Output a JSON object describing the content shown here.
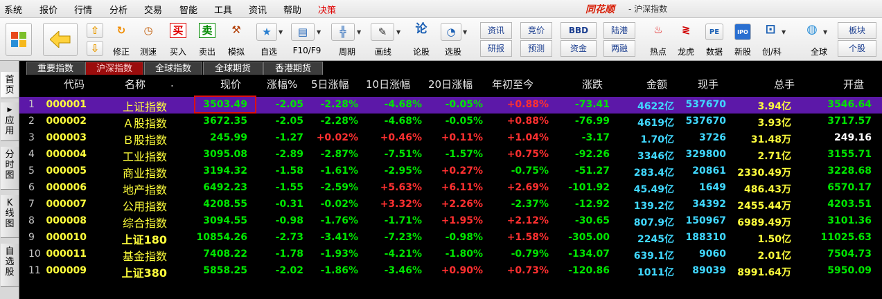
{
  "menu": [
    "系统",
    "报价",
    "行情",
    "分析",
    "交易",
    "智能",
    "工具",
    "资讯",
    "帮助",
    "决策"
  ],
  "app": {
    "title": "同花顺",
    "subtitle": "- 沪深指数"
  },
  "toolbar": {
    "labels": [
      "修正",
      "测速",
      "买入",
      "卖出",
      "模拟",
      "自选",
      "F10/F9",
      "周期",
      "画线",
      "论股",
      "选股",
      "热点",
      "龙虎",
      "数据",
      "新股",
      "创/科",
      "全球"
    ],
    "glyphs": {
      "buy": "买",
      "sell": "卖",
      "lun": "论",
      "bbd": "BBD",
      "pe": "PE",
      "ipo": "IPO"
    },
    "pairs": [
      [
        "资讯",
        "研报"
      ],
      [
        "竞价",
        "预测"
      ],
      [
        "BBD",
        "资金"
      ],
      [
        "陆港",
        "两融"
      ],
      [
        "板块",
        "个股"
      ]
    ]
  },
  "side_tabs": [
    "首页",
    "应用",
    "分时图",
    "K线图",
    "自选股"
  ],
  "tabs": [
    "重要指数",
    "沪深指数",
    "全球指数",
    "全球期货",
    "香港期货"
  ],
  "active_tab": "沪深指数",
  "columns": [
    "代码",
    "名称",
    ".",
    "现价",
    "涨幅%",
    "5日涨幅",
    "10日涨幅",
    "20日涨幅",
    "年初至今",
    "涨跌",
    "金额",
    "现手",
    "总手",
    "开盘"
  ],
  "rows": [
    {
      "n": "1",
      "code": "000001",
      "name": "上证指数",
      "price": "3503.49",
      "chg": "-2.05",
      "d5": "-2.28%",
      "d10": "-4.68%",
      "d20": "-0.05%",
      "ytd": "+0.88%",
      "diff": "-73.41",
      "amt": "4622亿",
      "hand": "537670",
      "vol": "3.94亿",
      "open": "3546.64"
    },
    {
      "n": "2",
      "code": "000002",
      "name": "Ａ股指数",
      "price": "3672.35",
      "chg": "-2.05",
      "d5": "-2.28%",
      "d10": "-4.68%",
      "d20": "-0.05%",
      "ytd": "+0.88%",
      "diff": "-76.99",
      "amt": "4619亿",
      "hand": "537670",
      "vol": "3.93亿",
      "open": "3717.57"
    },
    {
      "n": "3",
      "code": "000003",
      "name": "Ｂ股指数",
      "price": "245.99",
      "chg": "-1.27",
      "d5": "+0.02%",
      "d10": "+0.46%",
      "d20": "+0.11%",
      "ytd": "+1.04%",
      "diff": "-3.17",
      "amt": "1.70亿",
      "hand": "3726",
      "vol": "31.48万",
      "open": "249.16"
    },
    {
      "n": "4",
      "code": "000004",
      "name": "工业指数",
      "price": "3095.08",
      "chg": "-2.89",
      "d5": "-2.87%",
      "d10": "-7.51%",
      "d20": "-1.57%",
      "ytd": "+0.75%",
      "diff": "-92.26",
      "amt": "3346亿",
      "hand": "329800",
      "vol": "2.71亿",
      "open": "3155.71"
    },
    {
      "n": "5",
      "code": "000005",
      "name": "商业指数",
      "price": "3194.32",
      "chg": "-1.58",
      "d5": "-1.61%",
      "d10": "-2.95%",
      "d20": "+0.27%",
      "ytd": "-0.75%",
      "diff": "-51.27",
      "amt": "283.4亿",
      "hand": "20861",
      "vol": "2330.49万",
      "open": "3228.68"
    },
    {
      "n": "6",
      "code": "000006",
      "name": "地产指数",
      "price": "6492.23",
      "chg": "-1.55",
      "d5": "-2.59%",
      "d10": "+5.63%",
      "d20": "+6.11%",
      "ytd": "+2.69%",
      "diff": "-101.92",
      "amt": "45.49亿",
      "hand": "1649",
      "vol": "486.43万",
      "open": "6570.17"
    },
    {
      "n": "7",
      "code": "000007",
      "name": "公用指数",
      "price": "4208.55",
      "chg": "-0.31",
      "d5": "-0.02%",
      "d10": "+3.32%",
      "d20": "+2.26%",
      "ytd": "-2.37%",
      "diff": "-12.92",
      "amt": "139.2亿",
      "hand": "34392",
      "vol": "2455.44万",
      "open": "4203.51"
    },
    {
      "n": "8",
      "code": "000008",
      "name": "综合指数",
      "price": "3094.55",
      "chg": "-0.98",
      "d5": "-1.76%",
      "d10": "-1.71%",
      "d20": "+1.95%",
      "ytd": "+2.12%",
      "diff": "-30.65",
      "amt": "807.9亿",
      "hand": "150967",
      "vol": "6989.49万",
      "open": "3101.36"
    },
    {
      "n": "9",
      "code": "000010",
      "name": "上证180",
      "price": "10854.26",
      "chg": "-2.73",
      "d5": "-3.41%",
      "d10": "-7.23%",
      "d20": "-0.98%",
      "ytd": "+1.58%",
      "diff": "-305.00",
      "amt": "2245亿",
      "hand": "188310",
      "vol": "1.50亿",
      "open": "11025.63"
    },
    {
      "n": "10",
      "code": "000011",
      "name": "基金指数",
      "price": "7408.22",
      "chg": "-1.78",
      "d5": "-1.93%",
      "d10": "-4.21%",
      "d20": "-1.80%",
      "ytd": "-0.79%",
      "diff": "-134.07",
      "amt": "639.1亿",
      "hand": "9060",
      "vol": "2.01亿",
      "open": "7504.73"
    },
    {
      "n": "11",
      "code": "000009",
      "name": "上证380",
      "price": "5858.25",
      "chg": "-2.02",
      "d5": "-1.86%",
      "d10": "-3.46%",
      "d20": "+0.90%",
      "ytd": "+0.73%",
      "diff": "-120.86",
      "amt": "1011亿",
      "hand": "89039",
      "vol": "8991.64万",
      "open": "5950.09"
    }
  ],
  "colors": {
    "up": "#ff3030",
    "down": "#00e600",
    "neutral": "#ffffff",
    "amount": "#40d8ff",
    "code": "#ffff3c",
    "selected": "#5c18a8"
  }
}
